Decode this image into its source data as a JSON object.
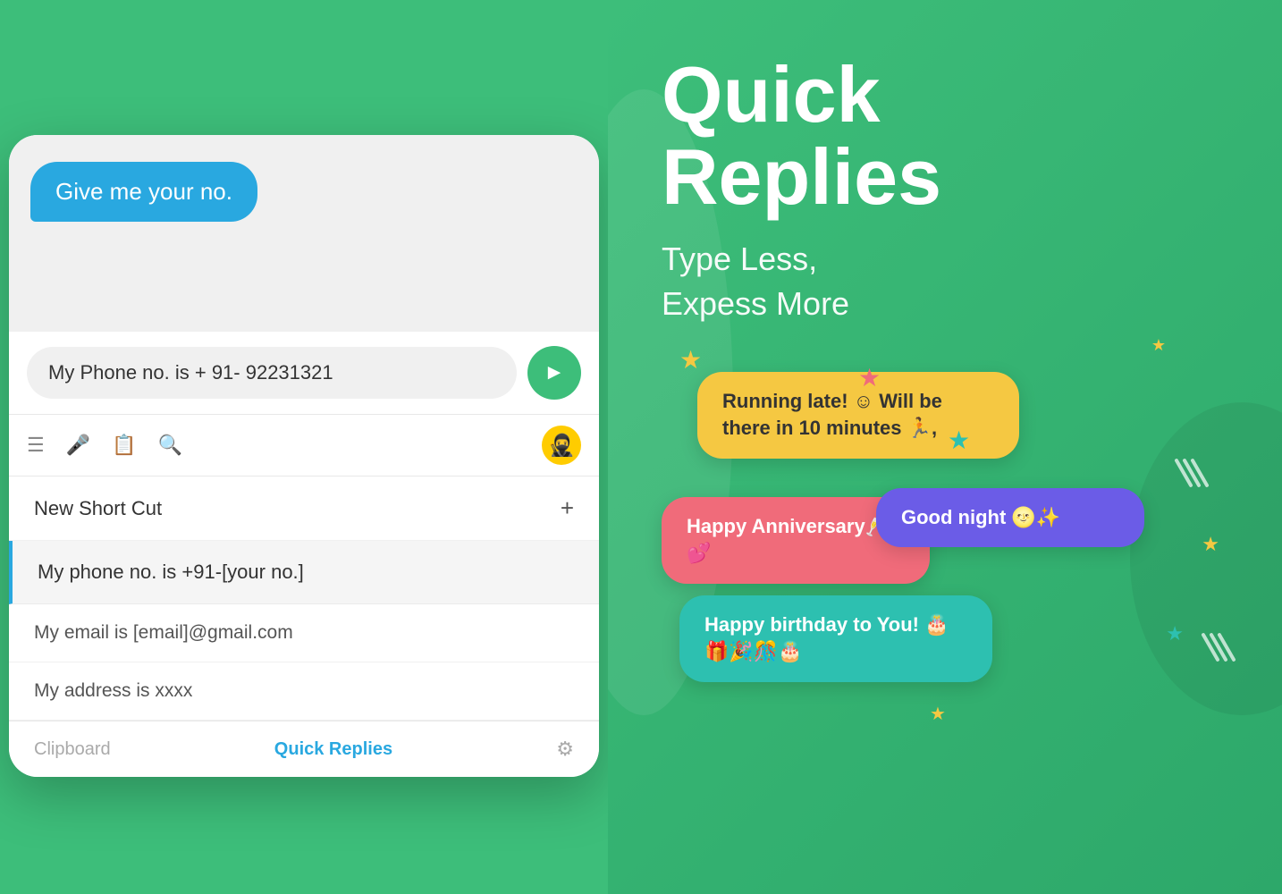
{
  "left": {
    "message_bubble": "Give me your no.",
    "input_value": "My Phone no. is + 91- 92231321",
    "send_btn_label": "Send",
    "toolbar_icons": [
      "menu",
      "mic",
      "clipboard",
      "search"
    ],
    "avatar_emoji": "🥷",
    "shortcut_header": "New Short Cut",
    "add_icon": "+",
    "shortcuts": [
      "My phone no. is +91-[your no.]",
      "My email is [email]@gmail.com",
      "My address is xxxx"
    ],
    "bottom_clipboard": "Clipboard",
    "bottom_quick_replies": "Quick Replies"
  },
  "right": {
    "title_line1": "Quick",
    "title_line2": "Replies",
    "subtitle_line1": "Type Less,",
    "subtitle_line2": "Expess More",
    "bubbles": [
      {
        "id": "bubble-running-late",
        "text": "Running late! ☺ Will be there in 10 minutes 🏃,",
        "color": "#f5c842",
        "text_color": "#333"
      },
      {
        "id": "bubble-anniversary",
        "text": "Happy Anniversary🥂💕",
        "color": "#f06b7a",
        "text_color": "#fff"
      },
      {
        "id": "bubble-goodnight",
        "text": "Good night 🌝✨",
        "color": "#6b5ce7",
        "text_color": "#fff"
      },
      {
        "id": "bubble-birthday",
        "text": "Happy birthday to You! 🎂🎁🎉🎊🎂",
        "color": "#2dc0b0",
        "text_color": "#fff"
      }
    ],
    "stars": [
      "⭐",
      "⭐",
      "⭐",
      "⭐",
      "⭐",
      "⭐"
    ],
    "star_colors": [
      "#f5c842",
      "#f06b7a",
      "#2dc0b0",
      "#f5c842",
      "#2dc0b0",
      "#f5c842"
    ]
  }
}
